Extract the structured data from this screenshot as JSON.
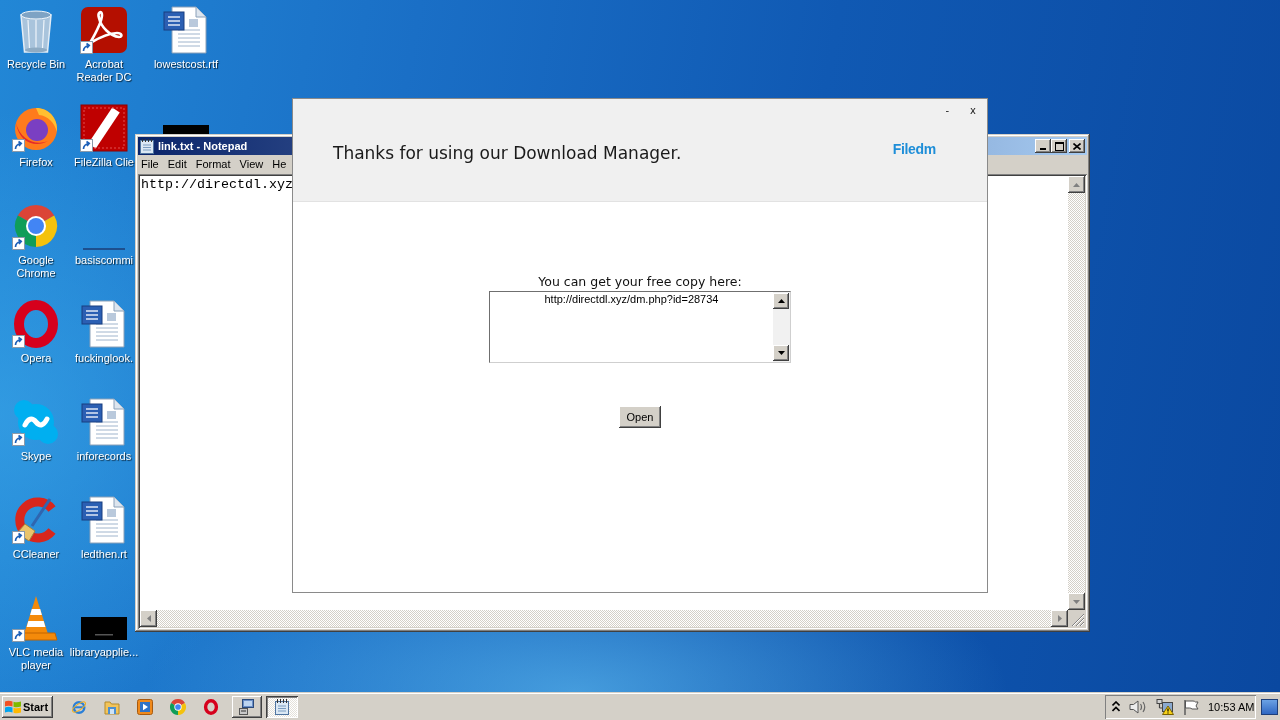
{
  "desktop_icons": [
    {
      "label": "Recycle Bin",
      "kind": "recycle_bin"
    },
    {
      "label": "Firefox",
      "kind": "firefox",
      "shortcut": true
    },
    {
      "label": "Google Chrome",
      "kind": "chrome",
      "shortcut": true
    },
    {
      "label": "Opera",
      "kind": "opera",
      "shortcut": true
    },
    {
      "label": "Skype",
      "kind": "skype",
      "shortcut": true
    },
    {
      "label": "CCleaner",
      "kind": "ccleaner",
      "shortcut": true
    },
    {
      "label": "VLC media player",
      "kind": "vlc",
      "shortcut": true
    },
    {
      "label": "Acrobat Reader DC",
      "kind": "acrobat",
      "shortcut": true
    },
    {
      "label": "FileZilla Clie",
      "kind": "filezilla",
      "shortcut": true
    },
    {
      "label": "basiscommi",
      "kind": "blank_thumbnail"
    },
    {
      "label": "fuckinglook.",
      "kind": "word_doc"
    },
    {
      "label": "inforecords",
      "kind": "word_doc"
    },
    {
      "label": "ledthen.rt",
      "kind": "word_doc"
    },
    {
      "label": "libraryapplie...",
      "kind": "thumbnail"
    },
    {
      "label": "lowestcost.rtf",
      "kind": "word_doc"
    },
    {
      "kind": "thumbnail_strip"
    }
  ],
  "notepad": {
    "title": "link.txt - Notepad",
    "menu": [
      "File",
      "Edit",
      "Format",
      "View",
      "He"
    ],
    "content": "http://directdl.xyz"
  },
  "dialog": {
    "controls": [
      "-",
      "x"
    ],
    "heading": "Thanks for using our Download Manager.",
    "logo": "Filedm",
    "prompt": "You can get your free copy here:",
    "link": "http://directdl.xyz/dm.php?id=28734",
    "button": "Open"
  },
  "taskbar": {
    "start": "Start",
    "quick_launch": [
      {
        "kind": "ie"
      },
      {
        "kind": "explorer"
      },
      {
        "kind": "media_player"
      },
      {
        "kind": "chrome"
      },
      {
        "kind": "opera"
      }
    ],
    "tasks": [
      {
        "kind": "installer",
        "selected": false
      },
      {
        "kind": "notepad",
        "selected": true
      }
    ],
    "tray": [
      {
        "kind": "chevron"
      },
      {
        "kind": "speaker"
      },
      {
        "kind": "network_warning"
      },
      {
        "kind": "flag"
      }
    ],
    "clock": "10:53 AM"
  }
}
